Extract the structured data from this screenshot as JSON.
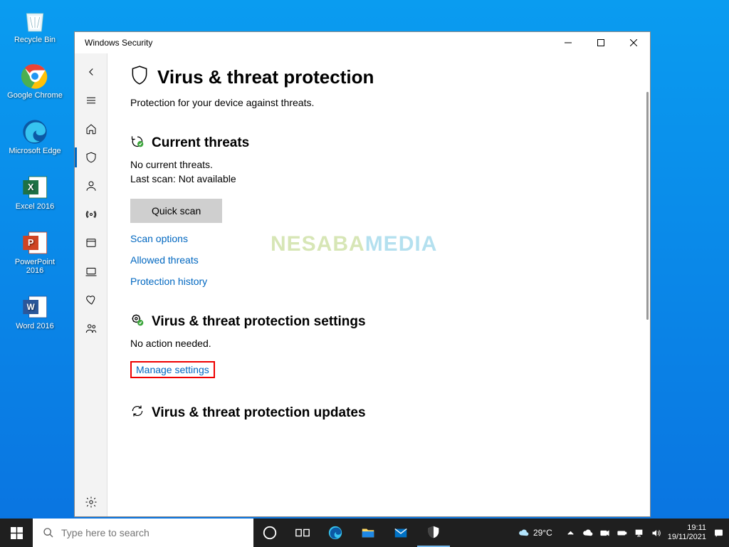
{
  "desktop_icons": [
    {
      "name": "recycle-bin",
      "label": "Recycle Bin"
    },
    {
      "name": "chrome",
      "label": "Google Chrome"
    },
    {
      "name": "edge",
      "label": "Microsoft Edge"
    },
    {
      "name": "excel",
      "label": "Excel 2016"
    },
    {
      "name": "powerpoint",
      "label": "PowerPoint 2016"
    },
    {
      "name": "word",
      "label": "Word 2016"
    }
  ],
  "window": {
    "title": "Windows Security",
    "nav": [
      {
        "name": "back",
        "icon": "arrow-left"
      },
      {
        "name": "menu",
        "icon": "hamburger"
      },
      {
        "name": "home",
        "icon": "home"
      },
      {
        "name": "virus",
        "icon": "shield",
        "active": true
      },
      {
        "name": "account",
        "icon": "person"
      },
      {
        "name": "firewall",
        "icon": "broadcast"
      },
      {
        "name": "app-browser",
        "icon": "window"
      },
      {
        "name": "device-security",
        "icon": "laptop"
      },
      {
        "name": "device-performance",
        "icon": "heart"
      },
      {
        "name": "family",
        "icon": "people"
      }
    ],
    "settings_label": "settings-icon",
    "page": {
      "heading": "Virus & threat protection",
      "subtitle": "Protection for your device against threats.",
      "current_threats": {
        "heading": "Current threats",
        "line1": "No current threats.",
        "line2": "Last scan: Not available",
        "button": "Quick scan",
        "links": [
          "Scan options",
          "Allowed threats",
          "Protection history"
        ]
      },
      "settings": {
        "heading": "Virus & threat protection settings",
        "status": "No action needed.",
        "link": "Manage settings"
      },
      "updates": {
        "heading": "Virus & threat protection updates"
      }
    }
  },
  "taskbar": {
    "search_placeholder": "Type here to search",
    "weather": "29°C",
    "time": "19:11",
    "date": "19/11/2021"
  },
  "watermark": {
    "a": "NESABA",
    "b": "MEDIA"
  }
}
